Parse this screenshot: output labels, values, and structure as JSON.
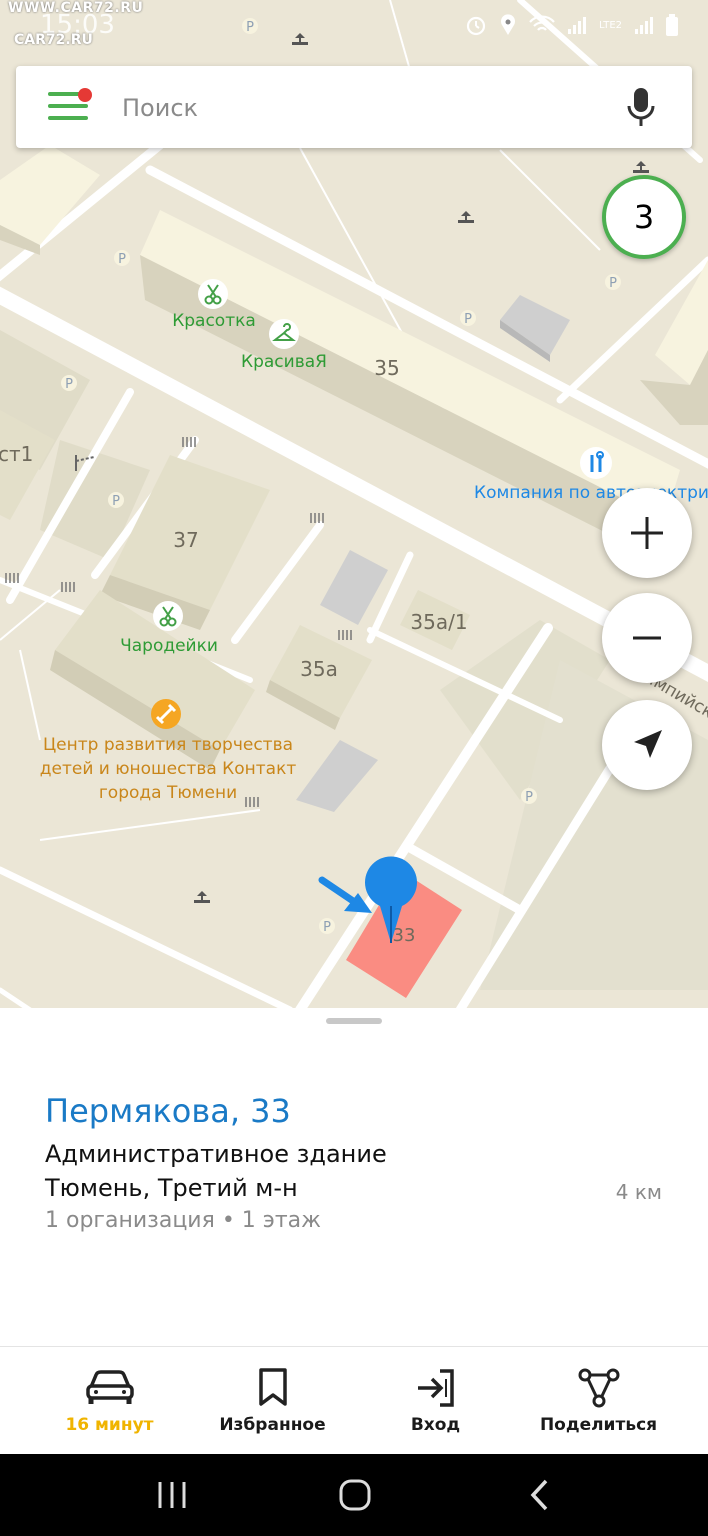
{
  "watermark": {
    "top": "WWW.CAR72.RU",
    "bottom": "CAR72.RU"
  },
  "status_bar": {
    "time": "15:03",
    "network": "LTE2"
  },
  "search": {
    "placeholder": "Поиск"
  },
  "map": {
    "cluster_count": "3",
    "labels": {
      "krasotka": "Красотка",
      "krasivaya": "КрасиваЯ",
      "bld_35": "35",
      "company": "Компания по автоэлектрике",
      "st1": "ст1",
      "bld_37": "37",
      "charodeyki": "Чародейки",
      "bld_35a1": "35а/1",
      "bld_35a": "35а",
      "center_line1": "Центр развития творчества",
      "center_line2": "детей и юношества Контакт",
      "center_line3": "города Тюмени",
      "street": "Олимпийская",
      "bld_33": "33",
      "parking": "P"
    }
  },
  "place": {
    "title": "Пермякова, 33",
    "type": "Административное здание",
    "address": "Тюмень, Третий м-н",
    "meta": "1 организация • 1 этаж",
    "distance": "4 км"
  },
  "bottom_nav": [
    {
      "label": "16 минут",
      "icon": "car-icon"
    },
    {
      "label": "Избранное",
      "icon": "bookmark-icon"
    },
    {
      "label": "Вход",
      "icon": "login-icon"
    },
    {
      "label": "Поделиться",
      "icon": "share-icon"
    }
  ],
  "colors": {
    "accent_green": "#4caf50",
    "link_blue": "#1a7ac6",
    "active_yellow": "#f0b400",
    "map_bg": "#ebe6d6",
    "building": "#f7f3df",
    "selected_building": "#fa8c82",
    "pin_blue": "#1e88e5"
  }
}
